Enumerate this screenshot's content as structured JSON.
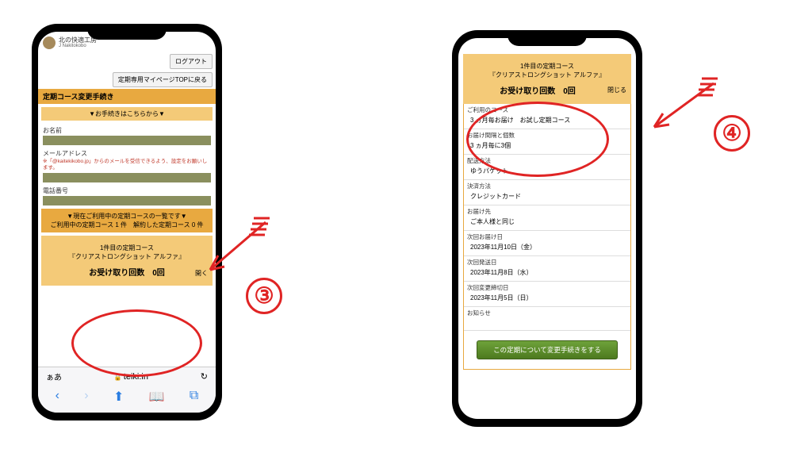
{
  "brand": {
    "name": "北の快適工房",
    "sub": "J Nakitokobo"
  },
  "left": {
    "logout": "ログアウト",
    "back_top": "定期専用マイページTOPに戻る",
    "section_title": "定期コース変更手続き",
    "procedure_here": "▼お手続きはこちらから▼",
    "name_label": "お名前",
    "email_label": "メールアドレス",
    "email_note": "※「@kaitekikobo.jp」からのメールを受信できるよう、設定をお願いします。",
    "phone_label": "電話番号",
    "list_header_l1": "▼現在ご利用中の定期コースの一覧です▼",
    "list_header_l2": "ご利用中の定期コース 1 件　解約した定期コース 0 件",
    "course_l1": "1件目の定期コース",
    "course_l2": "『クリアストロングショット アルファ』",
    "course_l3": "お受け取り回数　0回",
    "open": "開く",
    "aa": "ぁあ",
    "url": "teiki.in",
    "reload": "↻"
  },
  "right": {
    "top_l1": "1件目の定期コース",
    "top_l2": "『クリアストロングショット アルファ』",
    "top_l3": "お受け取り回数　0回",
    "close": "閉じる",
    "rows": {
      "course_label": "ご利用のコース",
      "course_val": "3 ヵ月毎お届け　お試し定期コース",
      "interval_label": "お届け間隔と個数",
      "interval_val": "3 ヵ月毎に3個",
      "ship_label": "配送方法",
      "ship_val": "ゆうパケット",
      "pay_label": "決済方法",
      "pay_val": "クレジットカード",
      "addr_label": "お届け先",
      "addr_val": "ご本人様と同じ",
      "next_deliv_label": "次回お届け日",
      "next_deliv_val": "2023年11月10日（金）",
      "next_ship_label": "次回発送日",
      "next_ship_val": "2023年11月8日（水）",
      "next_cutoff_label": "次回変更締切日",
      "next_cutoff_val": "2023年11月5日（日）",
      "notice_label": "お知らせ"
    },
    "green_btn": "この定期について変更手続きをする"
  },
  "anno": {
    "num3": "③",
    "num4": "④"
  }
}
